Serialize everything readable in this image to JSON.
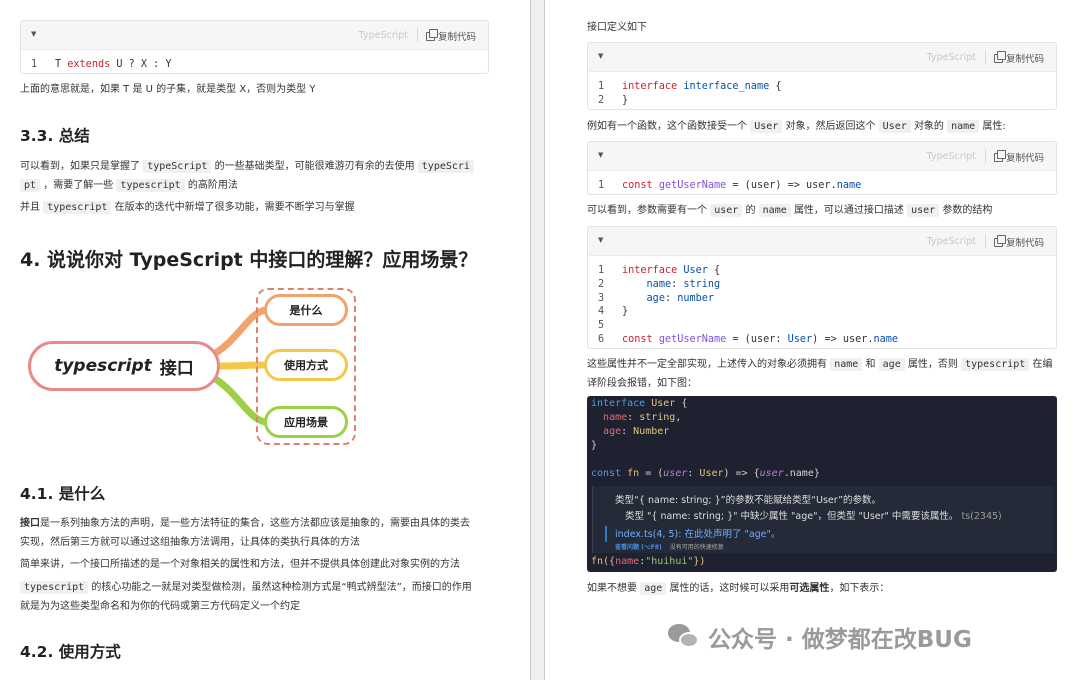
{
  "code_block": {
    "lang": "TypeScript",
    "copy": "复制代码"
  },
  "left": {
    "cb1": {
      "lines": [
        {
          "n": "1",
          "pre": "T ",
          "kw": "extends",
          "post": " U ? X : Y"
        }
      ]
    },
    "p1": "上面的意思就是，如果 T 是 U 的子集，就是类型 X，否则为类型 Y",
    "h_33": "3.3. 总结",
    "p2": {
      "a": "可以看到，如果只是掌握了",
      "c1": "typeScript",
      "b": "的一些基础类型，可能很难游刃有余的去使用",
      "c2a": "typeScri",
      "c2b": "pt",
      "d": "，需要了解一些",
      "c3": "typescript",
      "e": "的高阶用法"
    },
    "p3": {
      "a": "并且",
      "c": "typescript",
      "b": "在版本的迭代中新增了很多功能，需要不断学习与掌握"
    },
    "h_4": "4. 说说你对 TypeScript 中接口的理解？应用场景？",
    "mindmap": {
      "root_en": "typescript",
      "root_cn": "接口",
      "nodes": [
        "是什么",
        "使用方式",
        "应用场景"
      ],
      "colors": {
        "root": "#e88a8a",
        "n1": "#f2a26d",
        "n2": "#f4c84a",
        "n3": "#9dd046"
      }
    },
    "h_41": "4.1. 是什么",
    "p4": {
      "bold": "接口",
      "a": "是一系列抽象方法的声明，是一些方法特征的集合，这些方法都应该是抽象的，需要由具体的类去",
      "b": "实现，然后第三方就可以通过这组抽象方法调用，让具体的类执行具体的方法"
    },
    "p5": "简单来讲，一个接口所描述的是一个对象相关的属性和方法，但并不提供具体创建此对象实例的方法",
    "p6": {
      "c": "typescript",
      "a": "的核心功能之一就是对类型做检测，虽然这种检测方式是“鸭式辨型法”，而接口的作用",
      "b": "就是为为这些类型命名和为你的代码或第三方代码定义一个约定"
    },
    "h_42": "4.2. 使用方式"
  },
  "right": {
    "p1": "接口定义如下",
    "cb1": {
      "l1n": "1",
      "l1a": "interface",
      "l1b": "interface_name",
      "l1c": " {",
      "l2n": "2",
      "l2": "}"
    },
    "p2": {
      "a": "例如有一个函数，这个函数接受一个",
      "c1": "User",
      "b": "对象，然后返回这个",
      "c2": "User",
      "c": "对象的",
      "c3": "name",
      "d": "属性:"
    },
    "cb2": {
      "n": "1",
      "kw": "const",
      "fn": "getUserName",
      "mid": " = (user) => user.",
      "pr": "name"
    },
    "p3": {
      "a": "可以看到，参数需要有一个",
      "c1": "user",
      "b": "的",
      "c2": "name",
      "c": "属性，可以通过接口描述",
      "c3": "user",
      "d": "参数的结构"
    },
    "cb3": {
      "n": [
        "1",
        "2",
        "3",
        "4",
        "5",
        "6"
      ],
      "l1kw": "interface",
      "l1ty": "User",
      "l1end": " {",
      "l2pr": "name",
      "l2ty": "string",
      "l3pr": "age",
      "l3ty": "number",
      "l4": "}",
      "l6kw": "const",
      "l6fn": "getUserName",
      "l6a": " = (user: ",
      "l6ty": "User",
      "l6b": ") => user.",
      "l6pr": "name"
    },
    "p4": {
      "a": "这些属性并不一定全部实现，上述传入的对象必须拥有",
      "c1": "name",
      "b": "和",
      "c2": "age",
      "c": "属性，否则",
      "c3": "typescript",
      "d": "在编",
      "e": "译阶段会报错，如下图："
    },
    "dark": {
      "l1kw": "interface",
      "l1ty": "User",
      "l1end": " {",
      "l2p": "name",
      "l2t": "string",
      "l2end": ",",
      "l3p": "age",
      "l3t": "Number",
      "l4": "}",
      "l6kw": "const",
      "l6fn": "fn",
      "l6a": " = (",
      "l6p": "user",
      "l6b": ": ",
      "l6t": "User",
      "l6c": ") => {",
      "l6d": "user",
      "l6e": ".name}",
      "err1": "类型“{ name: string; }”的参数不能赋给类型“User”的参数。",
      "err2": "类型 \"{ name: string; }\" 中缺少属性 \"age\"，但类型 \"User\" 中需要该属性。",
      "err2code": "ts(2345)",
      "err3": "index.ts(4, 5): 在此处声明了 \"age\"。",
      "small1": "查看问题 (⌥F8)",
      "small2": "没有可用的快速修复",
      "last_a": "fn({",
      "last_p": "name",
      "last_b": ":",
      "last_s": "\"huihui\"",
      "last_c": "})"
    },
    "p5": {
      "a": "如果不想要",
      "c": "age",
      "b": "属性的话，这时候可以采用",
      "bold": "可选属性",
      "d": "，如下表示："
    }
  },
  "watermark": "公众号 · 做梦都在改BUG"
}
